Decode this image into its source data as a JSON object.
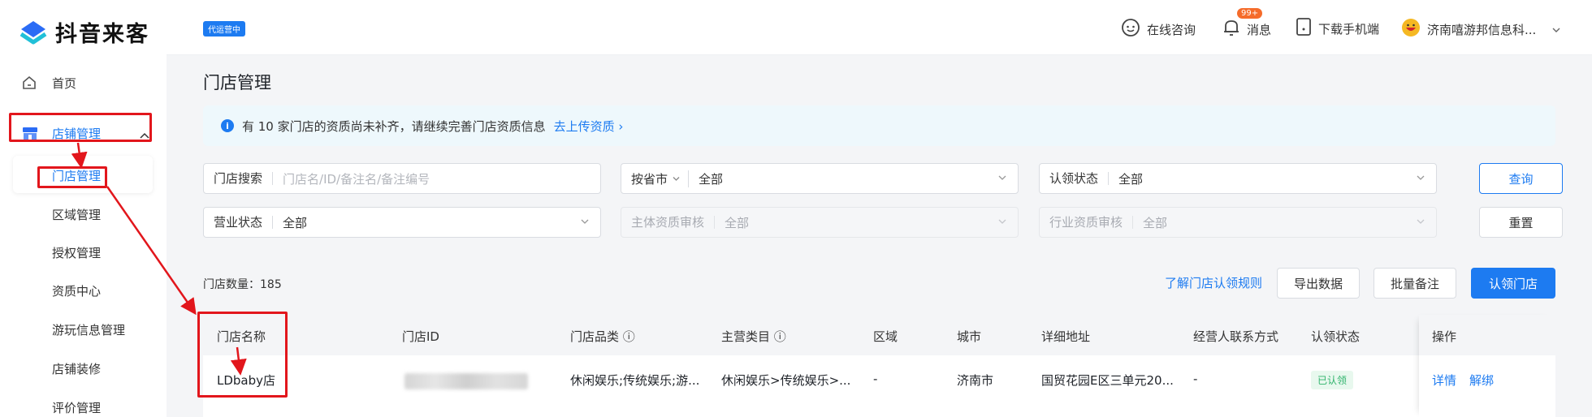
{
  "brand": {
    "name": "抖音来客"
  },
  "sidebar": {
    "items": [
      {
        "label": "首页",
        "icon": "home-icon"
      },
      {
        "label": "店铺管理",
        "icon": "store-icon"
      }
    ],
    "sub_items": [
      "门店管理",
      "区域管理",
      "授权管理",
      "资质中心",
      "游玩信息管理",
      "店铺装修",
      "评价管理"
    ]
  },
  "topbar": {
    "agency_badge": "代运营中",
    "consult": "在线咨询",
    "messages": "消息",
    "messages_count": "99+",
    "download": "下载手机端",
    "account": "济南嘻游邦信息科..."
  },
  "page": {
    "title": "门店管理",
    "notice_text": "有 10 家门店的资质尚未补齐，请继续完善门店资质信息",
    "notice_link": "去上传资质 ›"
  },
  "filters": {
    "store_search": {
      "label": "门店搜索",
      "placeholder": "门店名/ID/备注名/备注编号"
    },
    "province": {
      "mode": "按省市",
      "value": "全部"
    },
    "claim_status": {
      "label": "认领状态",
      "value": "全部"
    },
    "business_status": {
      "label": "营业状态",
      "value": "全部"
    },
    "entity_review": {
      "label": "主体资质审核",
      "value": "全部"
    },
    "industry_review": {
      "label": "行业资质审核",
      "value": "全部"
    },
    "query_button": "查询",
    "reset_button": "重置"
  },
  "toolbar": {
    "store_count": "门店数量：185",
    "rule_link": "了解门店认领规则",
    "export_button": "导出数据",
    "batch_note_button": "批量备注",
    "claim_button": "认领门店"
  },
  "table": {
    "headers": [
      "门店名称",
      "门店ID",
      "门店品类 ⓘ",
      "主营类目 ⓘ",
      "区域",
      "城市",
      "详细地址",
      "经营人联系方式",
      "认领状态",
      "操作"
    ],
    "rows": [
      {
        "name": "LDbaby店",
        "category": "休闲娱乐;传统娱乐;游...",
        "main_category": "休闲娱乐>传统娱乐>...",
        "region": "-",
        "city": "济南市",
        "address": "国贸花园E区三单元20...",
        "contact": "-",
        "status": "已认领",
        "actions": [
          "详情",
          "解绑"
        ]
      }
    ]
  },
  "colors": {
    "accent": "#1d7bf1",
    "annotation": "#e2161c",
    "success": "#2fb36b"
  }
}
